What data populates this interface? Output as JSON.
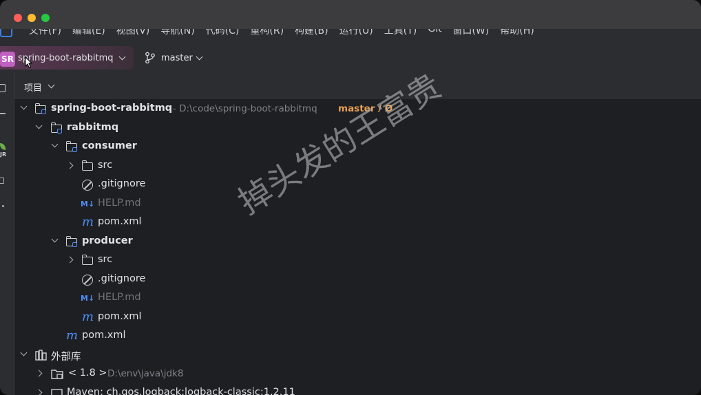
{
  "menubar": {
    "items": [
      "文件(F)",
      "编辑(E)",
      "视图(V)",
      "导航(N)",
      "代码(C)",
      "重构(R)",
      "构建(B)",
      "运行(U)",
      "工具(T)",
      "Git",
      "窗口(W)",
      "帮助(H)"
    ]
  },
  "toolbar": {
    "project_badge": "SR",
    "project_name": "spring-boot-rabbitmq",
    "branch": "master"
  },
  "panel": {
    "title": "项目"
  },
  "tree": {
    "root": {
      "name": "spring-boot-rabbitmq",
      "path": "- D:\\code\\spring-boot-rabbitmq",
      "branch_tag": "master / Ø"
    },
    "rabbitmq": "rabbitmq",
    "consumer": {
      "name": "consumer",
      "src": "src",
      "gitignore": ".gitignore",
      "help": "HELP.md",
      "pom": "pom.xml"
    },
    "producer": {
      "name": "producer",
      "src": "src",
      "gitignore": ".gitignore",
      "help": "HELP.md",
      "pom": "pom.xml"
    },
    "rabbitmq_pom": "pom.xml",
    "external": {
      "name": "外部库",
      "jdk_label": "< 1.8 >",
      "jdk_path": "D:\\env\\java\\jdk8",
      "maven": "Maven: ch.qos.logback:logback-classic:1.2.11"
    }
  },
  "icons": {
    "md_icon": "M↓",
    "maven_icon": "m"
  },
  "watermark": "掉头发的王富贵",
  "colors": {
    "accent": "#4f8ef7",
    "branch_tag": "#e8a055",
    "project_badge": "#c060c0"
  }
}
